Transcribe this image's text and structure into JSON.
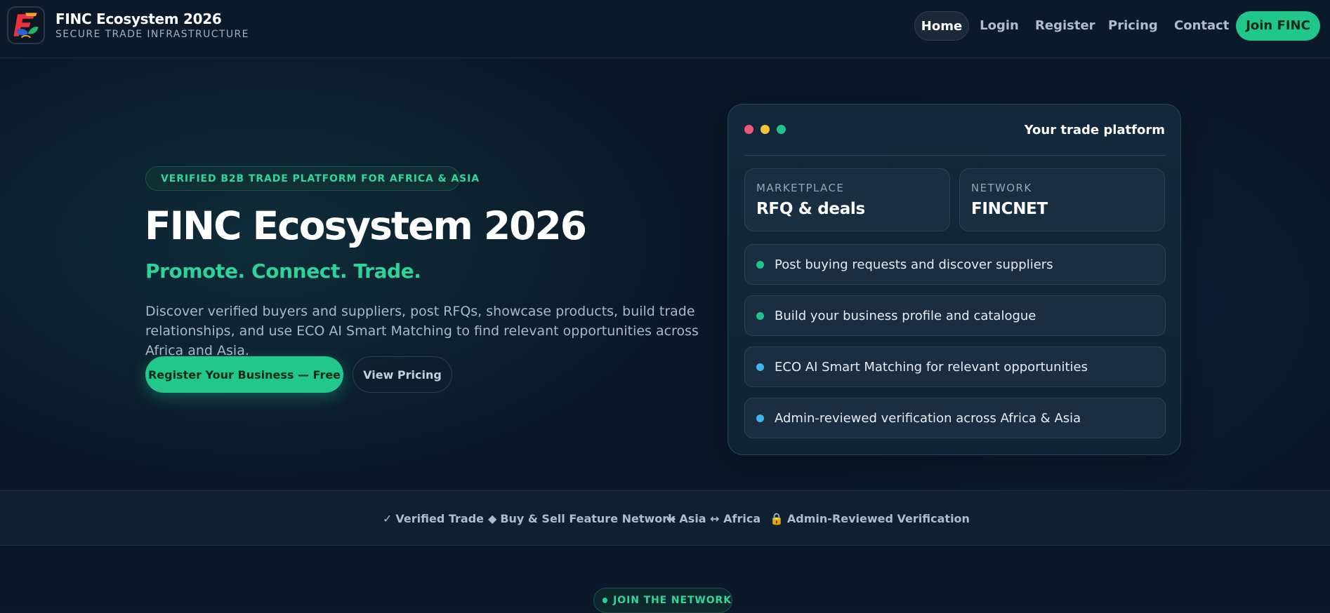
{
  "header": {
    "brand_title": "FINC Ecosystem 2026",
    "brand_subtitle": "SECURE TRADE INFRASTRUCTURE",
    "nav": {
      "home": "Home",
      "login": "Login",
      "register": "Register",
      "pricing": "Pricing",
      "contact": "Contact",
      "join": "Join FINC"
    }
  },
  "hero": {
    "badge": "VERIFIED B2B TRADE PLATFORM FOR AFRICA & ASIA",
    "title": "FINC Ecosystem 2026",
    "tagline": "Promote. Connect. Trade.",
    "description": "Discover verified buyers and suppliers, post RFQs, showcase products, build trade relationships, and use ECO AI Smart Matching to find relevant opportunities across Africa and Asia.",
    "primary_button": "Register Your Business — Free",
    "secondary_button": "View Pricing"
  },
  "card": {
    "title": "Your trade platform",
    "stats": [
      {
        "label": "MARKETPLACE",
        "value": "RFQ & deals"
      },
      {
        "label": "NETWORK",
        "value": "FINCNET"
      }
    ],
    "features": [
      {
        "text": "Post buying requests and discover suppliers",
        "dot_color": "#22c38b"
      },
      {
        "text": "Build your business profile and catalogue",
        "dot_color": "#22c38b"
      },
      {
        "text": "ECO AI Smart Matching for relevant opportunities",
        "dot_color": "#3db4f0"
      },
      {
        "text": "Admin-reviewed verification across Africa & Asia",
        "dot_color": "#3db4f0"
      }
    ]
  },
  "trust_strip": [
    {
      "icon": "check-icon",
      "glyph": "✓",
      "text": "Verified Trade"
    },
    {
      "icon": "diamond-icon",
      "glyph": "◆",
      "text": "Buy & Sell Feature Network"
    },
    {
      "icon": "arrows-icon",
      "glyph": "↔",
      "text": "Asia ↔ Africa"
    },
    {
      "icon": "lock-icon",
      "glyph": "🔒",
      "text": "Admin-Reviewed Verification"
    }
  ],
  "join_section": {
    "badge": "JOIN THE NETWORK"
  },
  "colors": {
    "accent": "#21c78b",
    "background": "#0a1829",
    "card": "#13283a"
  }
}
